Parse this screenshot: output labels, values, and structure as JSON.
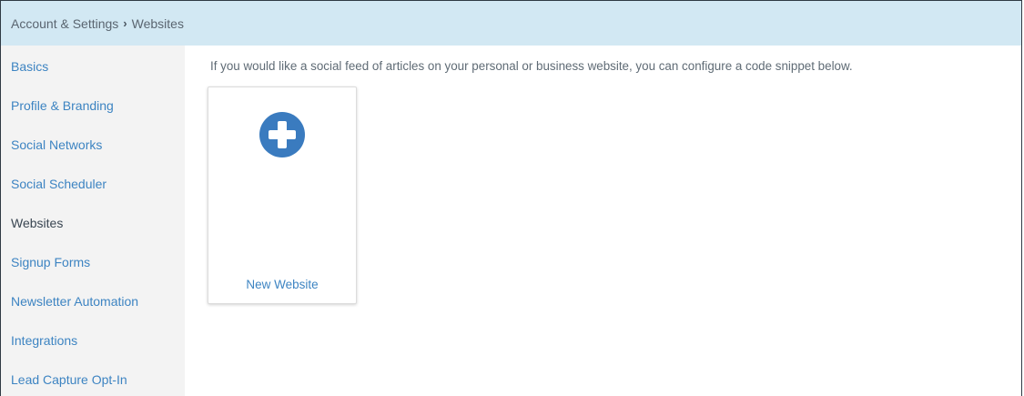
{
  "breadcrumb": {
    "parent": "Account & Settings",
    "separator": "›",
    "current": "Websites"
  },
  "sidebar": {
    "items": [
      {
        "label": "Basics",
        "active": false
      },
      {
        "label": "Profile & Branding",
        "active": false
      },
      {
        "label": "Social Networks",
        "active": false
      },
      {
        "label": "Social Scheduler",
        "active": false
      },
      {
        "label": "Websites",
        "active": true
      },
      {
        "label": "Signup Forms",
        "active": false
      },
      {
        "label": "Newsletter Automation",
        "active": false
      },
      {
        "label": "Integrations",
        "active": false
      },
      {
        "label": "Lead Capture Opt-In",
        "active": false
      }
    ]
  },
  "main": {
    "intro": "If you would like a social feed of articles on your personal or business website, you can configure a code snippet below.",
    "new_card": {
      "label": "New Website",
      "icon": "plus-circle-icon"
    }
  },
  "colors": {
    "header_bg": "#d2e8f3",
    "sidebar_bg": "#f3f3f3",
    "link": "#3d84c2",
    "active_item": "#3a4652",
    "plus_icon": "#3a7bbf"
  }
}
